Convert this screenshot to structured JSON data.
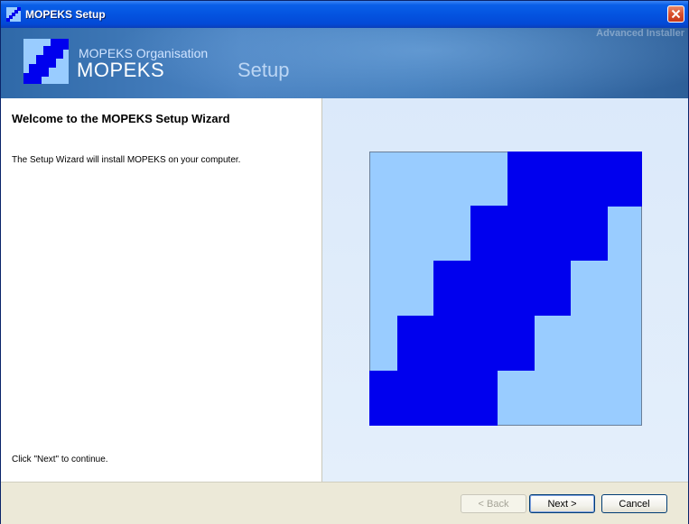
{
  "window": {
    "title": "MOPEKS Setup"
  },
  "banner": {
    "org": "MOPEKS Organisation",
    "product": "MOPEKS",
    "setup": "Setup",
    "watermark": "Advanced Installer"
  },
  "main": {
    "welcome_title": "Welcome to the MOPEKS Setup Wizard",
    "description": "The Setup Wizard will install MOPEKS on your computer.",
    "continue_hint": "Click \"Next\" to continue."
  },
  "buttons": {
    "back": "< Back",
    "next": "Next >",
    "cancel": "Cancel"
  },
  "colors": {
    "logo_dark": "#0000ee",
    "logo_light": "#99ccff"
  },
  "icons": {
    "app": "mopeks-app-icon",
    "close": "close-icon",
    "logo": "mopeks-logo"
  }
}
